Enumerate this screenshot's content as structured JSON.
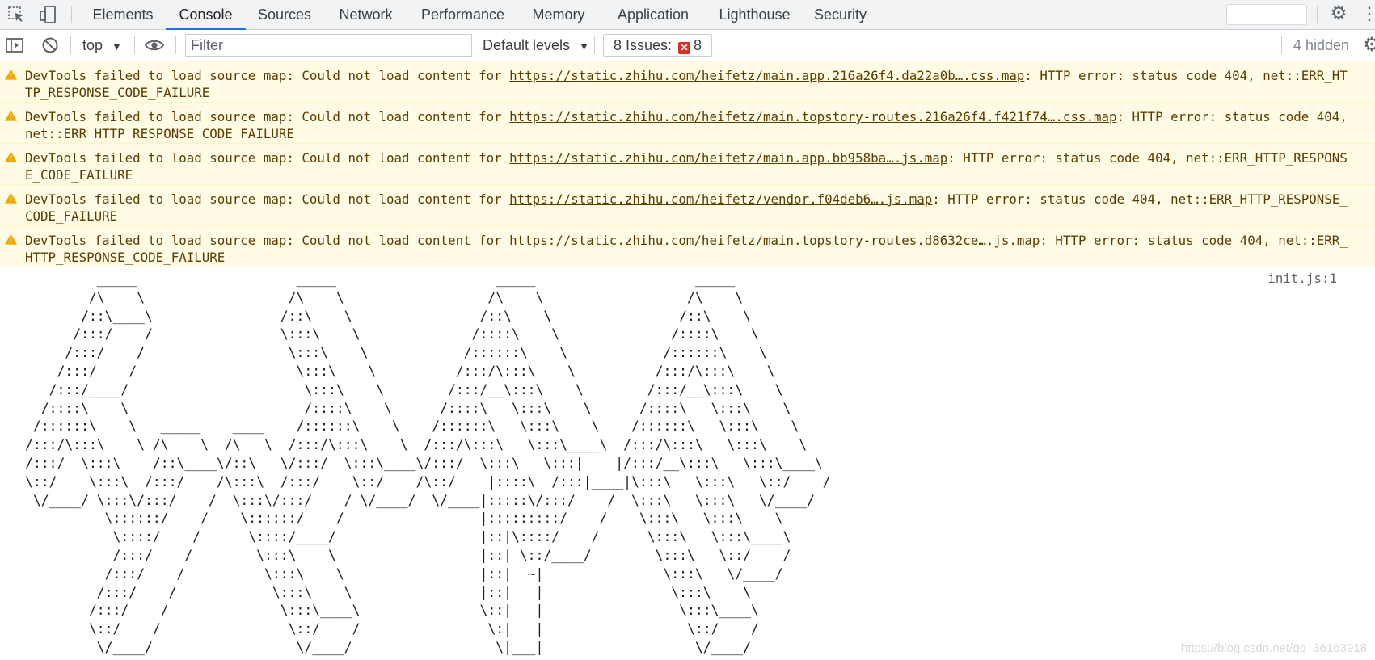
{
  "tabs": [
    {
      "label": "Elements",
      "active": false
    },
    {
      "label": "Console",
      "active": true
    },
    {
      "label": "Sources",
      "active": false
    },
    {
      "label": "Network",
      "active": false
    },
    {
      "label": "Performance",
      "active": false
    },
    {
      "label": "Memory",
      "active": false
    },
    {
      "label": "Application",
      "active": false
    },
    {
      "label": "Lighthouse",
      "active": false
    },
    {
      "label": "Security",
      "active": false
    }
  ],
  "toolbar": {
    "context": "top",
    "filter_placeholder": "Filter",
    "levels": "Default levels",
    "issues_label": "8 Issues:",
    "issues_count": "8",
    "hidden": "4 hidden"
  },
  "warnings": [
    {
      "prefix": "DevTools failed to load source map: Could not load content for ",
      "url": "https://static.zhihu.com/heifetz/main.app.216a26f4.da22a0b….css.map",
      "suffix": ": HTTP error: status code 404, net::ERR_HTTP_RESPONSE_CODE_FAILURE"
    },
    {
      "prefix": "DevTools failed to load source map: Could not load content for ",
      "url": "https://static.zhihu.com/heifetz/main.topstory-routes.216a26f4.f421f74….css.map",
      "suffix": ": HTTP error: status code 404, net::ERR_HTTP_RESPONSE_CODE_FAILURE"
    },
    {
      "prefix": "DevTools failed to load source map: Could not load content for ",
      "url": "https://static.zhihu.com/heifetz/main.app.bb958ba….js.map",
      "suffix": ": HTTP error: status code 404, net::ERR_HTTP_RESPONSE_CODE_FAILURE"
    },
    {
      "prefix": "DevTools failed to load source map: Could not load content for ",
      "url": "https://static.zhihu.com/heifetz/vendor.f04deb6….js.map",
      "suffix": ": HTTP error: status code 404, net::ERR_HTTP_RESPONSE_CODE_FAILURE"
    },
    {
      "prefix": "DevTools failed to load source map: Could not load content for ",
      "url": "https://static.zhihu.com/heifetz/main.topstory-routes.d8632ce….js.map",
      "suffix": ": HTTP error: status code 404, net::ERR_HTTP_RESPONSE_CODE_FAILURE"
    }
  ],
  "log": {
    "source": "init.js:1",
    "ascii": "         _____                    _____                    _____                    _____\n        /\\    \\                  /\\    \\                  /\\    \\                  /\\    \\\n       /::\\____\\                /::\\    \\                /::\\    \\                /::\\    \\\n      /:::/    /                \\:::\\    \\              /::::\\    \\              /::::\\    \\\n     /:::/    /                  \\:::\\    \\            /::::::\\    \\            /::::::\\    \\\n    /:::/    /                    \\:::\\    \\          /:::/\\:::\\    \\          /:::/\\:::\\    \\\n   /:::/____/                      \\:::\\    \\        /:::/__\\:::\\    \\        /:::/__\\:::\\    \\\n  /::::\\    \\                      /::::\\    \\      /::::\\   \\:::\\    \\      /::::\\   \\:::\\    \\\n /::::::\\    \\   _____    ____    /::::::\\    \\    /::::::\\   \\:::\\    \\    /::::::\\   \\:::\\    \\\n/:::/\\:::\\    \\ /\\    \\  /\\   \\  /:::/\\:::\\    \\  /:::/\\:::\\   \\:::\\____\\  /:::/\\:::\\   \\:::\\    \\\n/:::/  \\:::\\    /::\\____\\/::\\   \\/:::/  \\:::\\____\\/:::/  \\:::\\   \\:::|    |/:::/__\\:::\\   \\:::\\____\\\n\\::/    \\:::\\  /:::/    /\\:::\\  /:::/    \\::/    /\\::/    |::::\\  /:::|____|\\:::\\   \\:::\\   \\::/    /\n \\/____/ \\:::\\/:::/    /  \\:::\\/:::/    / \\/____/  \\/____|:::::\\/:::/    /  \\:::\\   \\:::\\   \\/____/\n          \\::::::/    /    \\::::::/    /                 |:::::::::/    /    \\:::\\   \\:::\\    \\\n           \\::::/    /      \\::::/____/                  |::|\\::::/    /      \\:::\\   \\:::\\____\\\n           /:::/    /        \\:::\\    \\                  |::| \\::/____/        \\:::\\   \\::/    /\n          /:::/    /          \\:::\\    \\                 |::|  ~|               \\:::\\   \\/____/\n         /:::/    /            \\:::\\    \\                |::|   |                \\:::\\    \\\n        /:::/    /              \\:::\\____\\               \\::|   |                 \\:::\\____\\\n        \\::/    /                \\::/    /                \\:|   |                  \\::/    /\n         \\/____/                  \\/____/                  \\|___|                   \\/____/"
  },
  "watermark": "https://blog.csdn.net/qq_36163918"
}
